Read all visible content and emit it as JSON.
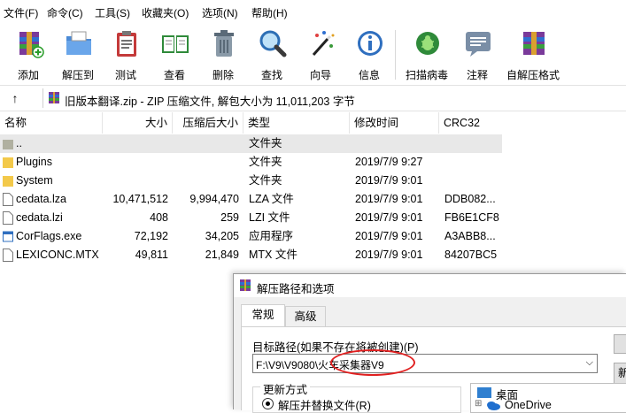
{
  "menu": [
    "文件(F)",
    "命令(C)",
    "工具(S)",
    "收藏夹(O)",
    "选项(N)",
    "帮助(H)"
  ],
  "toolbar": [
    {
      "label": "添加",
      "icon": "add-archive-icon"
    },
    {
      "label": "解压到",
      "icon": "extract-folder-icon"
    },
    {
      "label": "测试",
      "icon": "test-clipboard-icon"
    },
    {
      "label": "查看",
      "icon": "view-book-icon"
    },
    {
      "label": "删除",
      "icon": "trash-icon"
    },
    {
      "label": "查找",
      "icon": "magnifier-icon"
    },
    {
      "label": "向导",
      "icon": "wizard-wand-icon"
    },
    {
      "label": "信息",
      "icon": "info-icon"
    },
    {
      "label": "扫描病毒",
      "icon": "virus-scan-icon"
    },
    {
      "label": "注释",
      "icon": "comment-icon"
    },
    {
      "label": "自解压格式",
      "icon": "sfx-icon"
    }
  ],
  "address": {
    "up_icon": "up-arrow-icon",
    "text": "旧版本翻译.zip - ZIP 压缩文件, 解包大小为 11,011,203 字节"
  },
  "columns": [
    "名称",
    "大小",
    "压缩后大小",
    "类型",
    "修改时间",
    "CRC32"
  ],
  "files": [
    {
      "name": "..",
      "size": "",
      "packed": "",
      "type": "文件夹",
      "modified": "",
      "crc": "",
      "icon": "folder-up-icon"
    },
    {
      "name": "Plugins",
      "size": "",
      "packed": "",
      "type": "文件夹",
      "modified": "2019/7/9 9:27",
      "crc": "",
      "icon": "folder-icon"
    },
    {
      "name": "System",
      "size": "",
      "packed": "",
      "type": "文件夹",
      "modified": "2019/7/9 9:01",
      "crc": "",
      "icon": "folder-icon"
    },
    {
      "name": "cedata.lza",
      "size": "10,471,512",
      "packed": "9,994,470",
      "type": "LZA 文件",
      "modified": "2019/7/9 9:01",
      "crc": "DDB082...",
      "icon": "file-icon"
    },
    {
      "name": "cedata.lzi",
      "size": "408",
      "packed": "259",
      "type": "LZI 文件",
      "modified": "2019/7/9 9:01",
      "crc": "FB6E1CF8",
      "icon": "file-icon"
    },
    {
      "name": "CorFlags.exe",
      "size": "72,192",
      "packed": "34,205",
      "type": "应用程序",
      "modified": "2019/7/9 9:01",
      "crc": "A3ABB8...",
      "icon": "exe-icon"
    },
    {
      "name": "LEXICONC.MTX",
      "size": "49,811",
      "packed": "21,849",
      "type": "MTX 文件",
      "modified": "2019/7/9 9:01",
      "crc": "84207BC5",
      "icon": "file-icon"
    }
  ],
  "dialog": {
    "title": "解压路径和选项",
    "tabs": [
      "常规",
      "高级"
    ],
    "target_label": "目标路径(如果不存在将被创建)(P)",
    "target_value": "F:\\V9\\V9080\\火车采集器V9",
    "new_button": "新",
    "update_group": "更新方式",
    "radio_label": "解压并替换文件(R)",
    "tree": [
      "桌面",
      "OneDrive"
    ]
  },
  "colors": {
    "highlight": "#e02020",
    "selected_row": "#e8e8e8"
  }
}
